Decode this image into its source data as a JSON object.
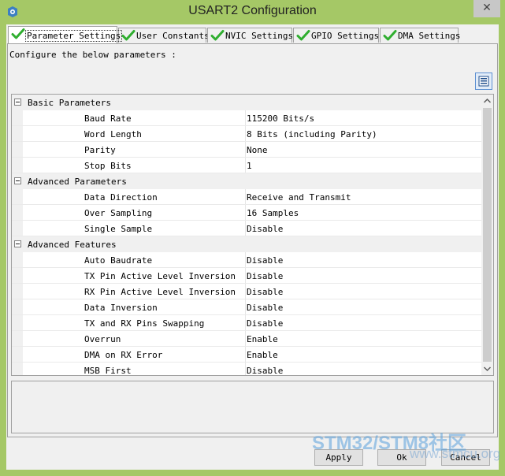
{
  "window": {
    "title": "USART2 Configuration",
    "close_glyph": "✕",
    "app_icon": "app-gear-icon",
    "frame_color": "#a5c866"
  },
  "tabs": [
    {
      "label": "Parameter Settings",
      "active": true
    },
    {
      "label": "User Constants",
      "active": false
    },
    {
      "label": "NVIC Settings",
      "active": false
    },
    {
      "label": "GPIO Settings",
      "active": false
    },
    {
      "label": "DMA Settings",
      "active": false
    }
  ],
  "panel": {
    "description": "Configure the below parameters :"
  },
  "grid": {
    "categories": [
      {
        "label": "Basic Parameters",
        "rows": [
          {
            "name": "Baud Rate",
            "value": "115200 Bits/s"
          },
          {
            "name": "Word Length",
            "value": "8 Bits (including Parity)"
          },
          {
            "name": "Parity",
            "value": "None"
          },
          {
            "name": "Stop Bits",
            "value": "1"
          }
        ]
      },
      {
        "label": "Advanced Parameters",
        "rows": [
          {
            "name": "Data Direction",
            "value": "Receive and Transmit"
          },
          {
            "name": "Over Sampling",
            "value": "16 Samples"
          },
          {
            "name": "Single Sample",
            "value": "Disable"
          }
        ]
      },
      {
        "label": "Advanced Features",
        "rows": [
          {
            "name": "Auto Baudrate",
            "value": "Disable"
          },
          {
            "name": "TX Pin Active Level Inversion",
            "value": "Disable"
          },
          {
            "name": "RX Pin Active Level Inversion",
            "value": "Disable"
          },
          {
            "name": "Data Inversion",
            "value": "Disable"
          },
          {
            "name": "TX and RX Pins Swapping",
            "value": "Disable"
          },
          {
            "name": "Overrun",
            "value": "Enable"
          },
          {
            "name": "DMA on RX Error",
            "value": "Enable"
          },
          {
            "name": "MSB First",
            "value": "Disable"
          }
        ]
      }
    ]
  },
  "buttons": {
    "apply": "Apply",
    "ok": "Ok",
    "cancel": "Cancel"
  },
  "watermark": {
    "text": "STM32/STM8社区",
    "url_text": "www.stmcu.org"
  }
}
